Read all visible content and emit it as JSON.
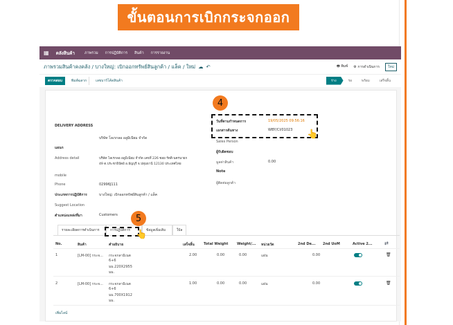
{
  "banner": {
    "title": "ขั้นตอนการเบิกกระจกออก"
  },
  "navbar": {
    "app_name": "คลังสินค้า",
    "menu": [
      "ภาพรวม",
      "การปฏิบัติการ",
      "สินค้า",
      "การรายงาน"
    ]
  },
  "breadcrumb": {
    "path": "ภาพรวมสินค้าคงคลัง / บางใหญ่: เบิกออกทรัพย์สินลูกค้า / แล็ค / ใหม่",
    "tools": {
      "print": "พิมพ์",
      "action": "การดำเนินการ",
      "new": "ใหม่"
    }
  },
  "actions": {
    "check": "ตรวจสอบ",
    "print_label": "พิมพ์ฉลาก",
    "unreserve": "เลขบาร์โค้ดสินค้า"
  },
  "statusbar": [
    "ร่าง",
    "รอ",
    "พร้อม",
    "เสร็จสิ้น"
  ],
  "form": {
    "delivery_address": "DELIVERY ADDRESS",
    "partner": "บริษัท โลเรกลอ อลูมิเนียม จำกัด",
    "hint_label": "แผนก",
    "address_label": "Address detail",
    "address_line1": "บริษัท โลเรกลอ อลูมิเนียม จำกัด เลขที่ 226 ซอย รัตติ-นครนายก",
    "address_line2": "49 ต.ประชาธิปัตย์ อ.ธัญบุรี จ.ปทุมธานี 12130 ประเทศไทย",
    "mobile_label": "mobile",
    "phone_label": "Phone",
    "phone_value": "02996J111",
    "operation_type_label": "ประเภทการปฏิบัติการ",
    "operation_type_value": "บางใหญ่: เบิกออกทรัพย์สินลูกค้า / แล็ค",
    "suggest_label": "Suggest Location",
    "source_loc_label": "ตำแหน่งแหล่งที่มา",
    "source_loc_value": "Customers",
    "scheduled_label": "วันที่ตามกำหนดการ",
    "scheduled_value": "19/05/2025 09:56:16",
    "source_doc_label": "เอกสารต้นทาง",
    "source_doc_value": "WBY/CI/01023",
    "sales_person_label": "Sales Person",
    "responsible_label": "ผู้รับผิดชอบ",
    "total_label": "มูลค่าสินค้า",
    "total_value": "0.00",
    "note_label": "Note",
    "contact_label": "ผู้ติดต่อลูกค้า"
  },
  "tabs": [
    "รายละเอียดการดำเนินการ",
    "การปฏิบัติการ",
    "ข้อมูลเพิ่มเติม",
    "ใบ้ล"
  ],
  "table": {
    "headers": [
      "No.",
      "สินค้า",
      "คำอธิบาย",
      "เสร็จสิ้น",
      "Total Weight",
      "Weight/...",
      "หน่วยวัด",
      "2nd De...",
      "2nd UoM",
      "Active 2..."
    ],
    "rows": [
      {
        "no": "1",
        "product": "[LM-00] กระจ...",
        "desc": [
          "กระจกลามิเนต",
          "6+6",
          "มม.220X2955",
          "มม."
        ],
        "done": "2.00",
        "weight": "0.00",
        "weight_unit": "0.00",
        "uom": "แผ่น",
        "second_demand": "0.00"
      },
      {
        "no": "2",
        "product": "[LM-00] กระจ...",
        "desc": [
          "กระจกลามิเนต",
          "6+6",
          "มม.700X1912",
          "มม."
        ],
        "done": "1.00",
        "weight": "0.00",
        "weight_unit": "0.00",
        "uom": "แผ่น",
        "second_demand": "0.00"
      }
    ],
    "add_line": "เพิ่มไลน์"
  },
  "callouts": {
    "step4": "4",
    "step5": "5"
  },
  "colors": {
    "brand": "#714b67",
    "accent": "#017e84",
    "callout": "#f27a1f"
  }
}
